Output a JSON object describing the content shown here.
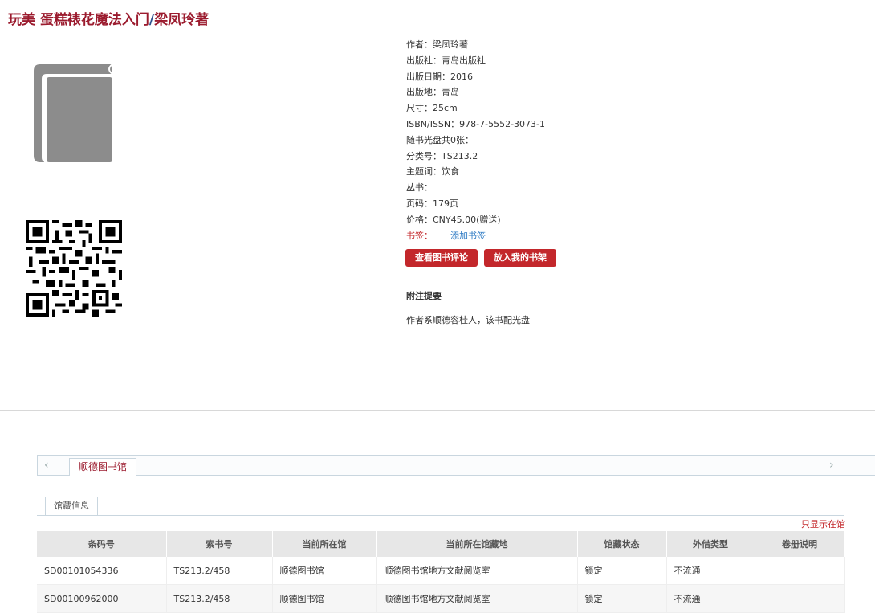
{
  "page": {
    "title_main": "玩美 蛋糕裱花魔法入门",
    "title_sep": "/",
    "title_author": "梁凤玲著"
  },
  "info": {
    "rows": [
      "作者：梁凤玲著",
      "出版社：青岛出版社",
      "出版日期：2016",
      "出版地：青岛",
      "尺寸：25cm",
      "ISBN/ISSN：978-7-5552-3073-1",
      "随书光盘共0张：",
      "分类号：TS213.2",
      "主题词：饮食",
      "丛书：",
      "页码：179页",
      "价格：CNY45.00(赠送)"
    ],
    "bookmark_label": "书签：",
    "bookmark_link": "添加书签"
  },
  "buttons": {
    "review": "查看图书评论",
    "shelf": "放入我的书架"
  },
  "note": {
    "title": "附注提要",
    "text": "作者系顺德容桂人，该书配光盘"
  },
  "library": {
    "tab": "顺德图书馆",
    "subtab": "馆藏信息",
    "only_in": "只显示在馆",
    "columns": [
      "条码号",
      "索书号",
      "当前所在馆",
      "当前所在馆藏地",
      "馆藏状态",
      "外借类型",
      "卷册说明"
    ],
    "rows": [
      [
        "SD00101054336",
        "TS213.2/458",
        "顺德图书馆",
        "顺德图书馆地方文献阅览室",
        "锁定",
        "不流通",
        ""
      ],
      [
        "SD00100962000",
        "TS213.2/458",
        "顺德图书馆",
        "顺德图书馆地方文献阅览室",
        "锁定",
        "不流通",
        ""
      ]
    ]
  },
  "colors": {
    "accent": "#c3272b",
    "title": "#9b1b2e",
    "link": "#2e7bc4",
    "cover": "#8c8c8c"
  },
  "icons": {
    "cover": "book-cover-icon",
    "qr": "qr-code",
    "left": "chevron-left-icon",
    "right": "chevron-right-icon"
  }
}
